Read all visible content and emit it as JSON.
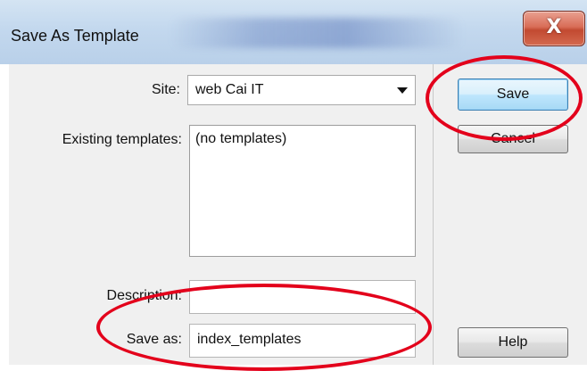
{
  "dialog": {
    "title": "Save As Template",
    "close_glyph": "X"
  },
  "form": {
    "site_label": "Site:",
    "site_value": "web Cai IT",
    "existing_label": "Existing templates:",
    "existing_items": [
      "(no templates)"
    ],
    "description_label": "Description:",
    "description_value": "",
    "save_as_label": "Save as:",
    "save_as_value": "index_templates"
  },
  "buttons": {
    "save": "Save",
    "cancel": "Cancel",
    "help": "Help"
  },
  "annotations": {
    "highlight_color": "#e3001b"
  }
}
